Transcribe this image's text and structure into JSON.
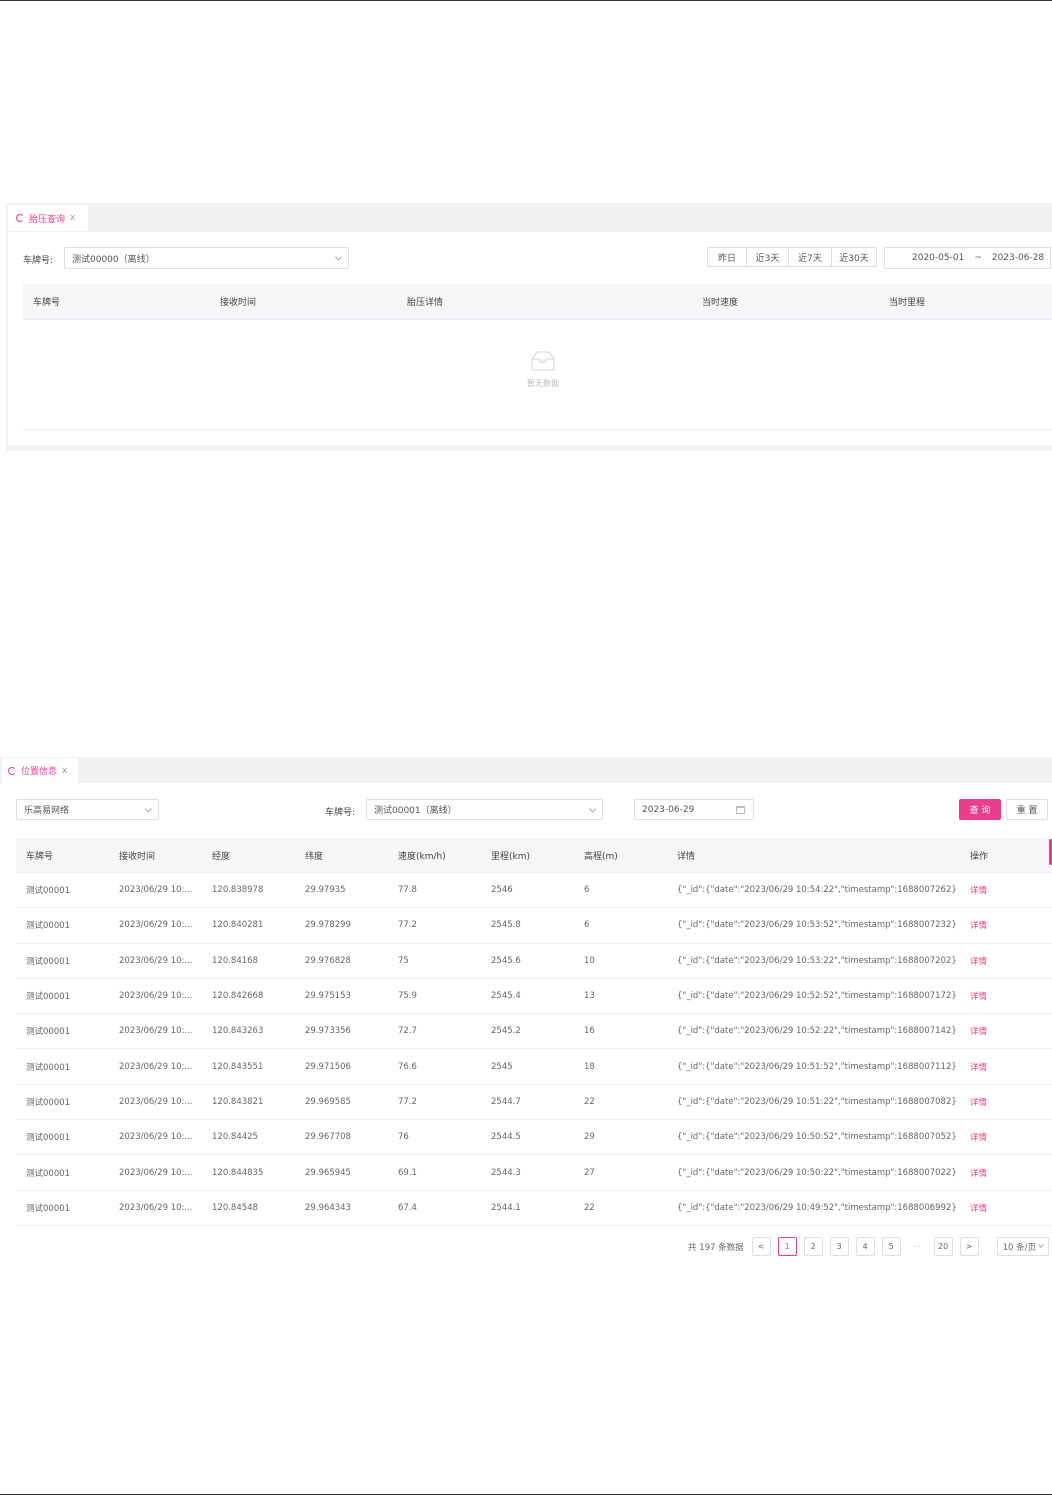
{
  "tire_panel": {
    "tab_label": "胎压查询",
    "tab_close": "x",
    "plate_label": "车牌号:",
    "plate_value": "测试00000（离线）",
    "quick_ranges": [
      "昨日",
      "近3天",
      "近7天",
      "近30天"
    ],
    "date_start": "2020-05-01",
    "date_sep": "~",
    "date_end": "2023-06-28",
    "columns": [
      "车牌号",
      "接收时间",
      "胎压详情",
      "当时速度",
      "当时里程"
    ],
    "empty_text": "暂无数据"
  },
  "position_panel": {
    "tab_label": "位置信息",
    "tab_close": "x",
    "org_value": "乐高易网络",
    "plate_label": "车牌号:",
    "plate_value": "测试00001（离线）",
    "date_value": "2023-06-29",
    "query_label": "查 询",
    "reset_label": "重 置",
    "columns": [
      "车牌号",
      "接收时间",
      "经度",
      "纬度",
      "速度(km/h)",
      "里程(km)",
      "高程(m)",
      "详情",
      "操作"
    ],
    "rows": [
      [
        "测试00001",
        "2023/06/29 10:...",
        "120.838978",
        "29.97935",
        "77.8",
        "2546",
        "6",
        "{\"_id\":{\"date\":\"2023/06/29 10:54:22\",\"timestamp\":1688007262},\"ala...",
        "详情"
      ],
      [
        "测试00001",
        "2023/06/29 10:...",
        "120.840281",
        "29.978299",
        "77.2",
        "2545.8",
        "6",
        "{\"_id\":{\"date\":\"2023/06/29 10:53:52\",\"timestamp\":1688007232},\"ala...",
        "详情"
      ],
      [
        "测试00001",
        "2023/06/29 10:...",
        "120.84168",
        "29.976828",
        "75",
        "2545.6",
        "10",
        "{\"_id\":{\"date\":\"2023/06/29 10:53:22\",\"timestamp\":1688007202},\"ala...",
        "详情"
      ],
      [
        "测试00001",
        "2023/06/29 10:...",
        "120.842668",
        "29.975153",
        "75.9",
        "2545.4",
        "13",
        "{\"_id\":{\"date\":\"2023/06/29 10:52:52\",\"timestamp\":1688007172},\"ala...",
        "详情"
      ],
      [
        "测试00001",
        "2023/06/29 10:...",
        "120.843263",
        "29.973356",
        "72.7",
        "2545.2",
        "16",
        "{\"_id\":{\"date\":\"2023/06/29 10:52:22\",\"timestamp\":1688007142},\"ala...",
        "详情"
      ],
      [
        "测试00001",
        "2023/06/29 10:...",
        "120.843551",
        "29.971506",
        "76.6",
        "2545",
        "18",
        "{\"_id\":{\"date\":\"2023/06/29 10:51:52\",\"timestamp\":1688007112},\"ala...",
        "详情"
      ],
      [
        "测试00001",
        "2023/06/29 10:...",
        "120.843821",
        "29.969585",
        "77.2",
        "2544.7",
        "22",
        "{\"_id\":{\"date\":\"2023/06/29 10:51:22\",\"timestamp\":1688007082},\"ala...",
        "详情"
      ],
      [
        "测试00001",
        "2023/06/29 10:...",
        "120.84425",
        "29.967708",
        "76",
        "2544.5",
        "29",
        "{\"_id\":{\"date\":\"2023/06/29 10:50:52\",\"timestamp\":1688007052},\"ala...",
        "详情"
      ],
      [
        "测试00001",
        "2023/06/29 10:...",
        "120.844835",
        "29.965945",
        "69.1",
        "2544.3",
        "27",
        "{\"_id\":{\"date\":\"2023/06/29 10:50:22\",\"timestamp\":1688007022},\"ala...",
        "详情"
      ],
      [
        "测试00001",
        "2023/06/29 10:...",
        "120.84548",
        "29.964343",
        "67.4",
        "2544.1",
        "22",
        "{\"_id\":{\"date\":\"2023/06/29 10:49:52\",\"timestamp\":1688006992},\"ala...",
        "详情"
      ]
    ],
    "pagination": {
      "total_text": "共 197 条数据",
      "prev": "<",
      "pages": [
        "1",
        "2",
        "3",
        "4",
        "5"
      ],
      "ellipsis": "···",
      "last_page": "20",
      "next": ">",
      "page_size": "10 条/页"
    }
  },
  "colors": {
    "accent": "#e83e8c",
    "panel_bg": "#f0f1f3",
    "header_bg": "#f5f6f8"
  }
}
